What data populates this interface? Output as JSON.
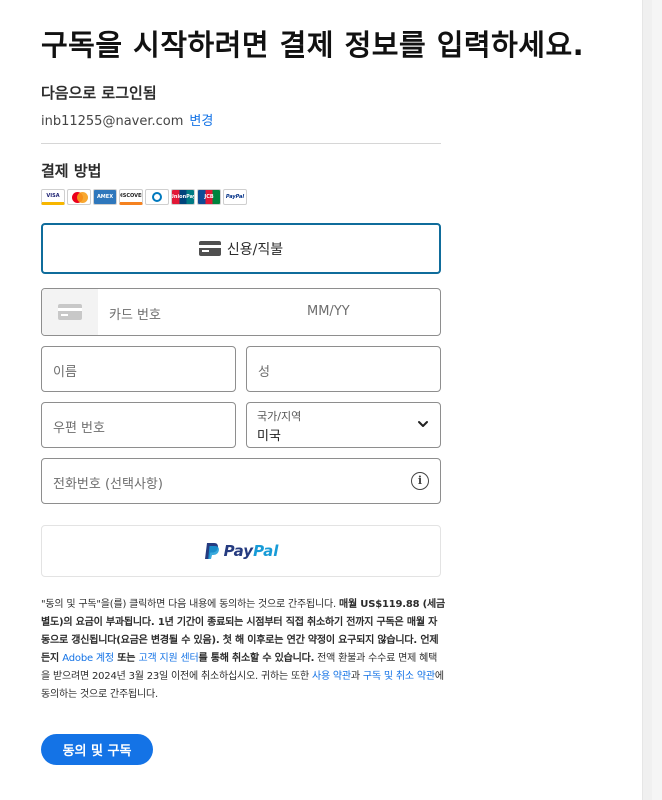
{
  "header": {
    "title": "구독을 시작하려면 결제 정보를 입력하세요."
  },
  "account": {
    "signed_in_label": "다음으로 로그인됨",
    "email": "inb11255@naver.com",
    "change_link": "변경"
  },
  "payment": {
    "heading": "결제 방법",
    "card_logos": [
      {
        "name": "visa-logo",
        "text": "VISA"
      },
      {
        "name": "mastercard-logo",
        "text": ""
      },
      {
        "name": "amex-logo",
        "text": "AMEX"
      },
      {
        "name": "discover-logo",
        "text": "DISCOVER"
      },
      {
        "name": "diners-club-logo",
        "text": ""
      },
      {
        "name": "unionpay-logo",
        "text": "UnionPay"
      },
      {
        "name": "jcb-logo",
        "text": "JCB"
      },
      {
        "name": "paypal-logo",
        "text": "PayPal"
      }
    ],
    "method_label": "신용/직불"
  },
  "form": {
    "card_number_placeholder": "카드 번호",
    "expiry_placeholder": "MM/YY",
    "first_name_placeholder": "이름",
    "last_name_placeholder": "성",
    "postal_placeholder": "우편 번호",
    "country_label": "국가/지역",
    "country_value": "미국",
    "phone_placeholder": "전화번호 (선택사항)"
  },
  "paypal": {
    "pay": "Pay",
    "pal": "Pal"
  },
  "legal": {
    "p1": "\"동의 및 구독\"을(를) 클릭하면 다음 내용에 동의하는 것으로 간주됩니다. ",
    "b1": "매월 US$119.88 (세금 별도)의 요금이 부과됩니다. 1년 기간이 종료되는 시점부터 직접 취소하기 전까지 구독은 매월 자동으로 갱신됩니다(요금은 변경될 수 있음). 첫 해 이후로는 연간 약정이 요구되지 않습니다. 언제든지 ",
    "link1": "Adobe 계정",
    "b2": " 또는 ",
    "link2": "고객 지원 센터",
    "b3": "를 통해 취소할 수 있습니다.",
    "p2": " 전액 환불과 수수료 면제 혜택을 받으려면 2024년 3월 23일 이전에 취소하십시오. 귀하는 또한 ",
    "link3": "사용 약관",
    "p3": "과 ",
    "link4": "구독 및 취소 약관",
    "p4": "에 동의하는 것으로 간주됩니다."
  },
  "submit": {
    "label": "동의 및 구독"
  },
  "colors": {
    "accent": "#1473e6",
    "selected_border": "#0f6c9b"
  }
}
